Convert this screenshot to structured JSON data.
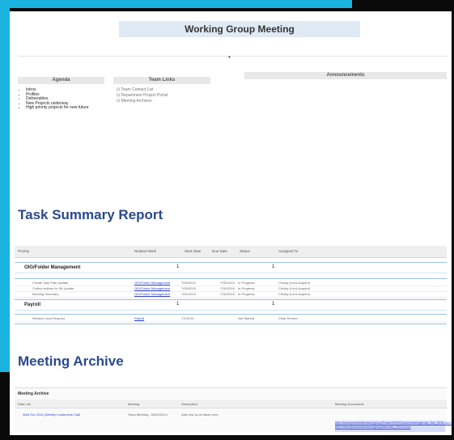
{
  "page": {
    "title": "Working Group Meeting",
    "separator_glyph": "•"
  },
  "agenda": {
    "heading": "Agenda",
    "items": [
      "Intros",
      "Profiles",
      "Deliverables",
      "New Projects underway",
      "High priority projects for new future"
    ]
  },
  "team_links": {
    "heading": "Team Links",
    "items": [
      "Team Contact List",
      "Department Project Portal",
      "Meeting Archives"
    ]
  },
  "announcements": {
    "heading": "Announcements"
  },
  "task_summary": {
    "title": "Task Summary Report",
    "columns": [
      "Priority",
      "Related Work",
      "Start Date",
      "Due Date",
      "Status",
      "Assigned To"
    ],
    "groups": [
      {
        "label": "OIG/Folder Management",
        "count_left": "1",
        "count_right": "1",
        "rows": [
          [
            "Create Task Plan Update",
            "OIG/Folder Management",
            "7/05/2015",
            "7/30/2015",
            "In Progress",
            "Christy (Lord-Acquire)"
          ],
          [
            "Collect actions for IM Update",
            "OIG/Folder Management",
            "7/05/2015",
            "7/30/2015",
            "In Progress",
            "Christy (Lord-Acquire)"
          ],
          [
            "Meeting Summary",
            "OIG/Folder Management",
            "7/01/2015",
            "7/30/2015",
            "In Progress",
            "Christy (Lord-Acquire)"
          ]
        ]
      },
      {
        "label": "Payroll",
        "count_left": "1",
        "count_right": "1",
        "rows": [
          [
            "Review Local Request",
            "Payroll",
            "7/1/2015",
            "",
            "Not Started",
            "Clear Renner"
          ]
        ]
      }
    ]
  },
  "meeting_archive": {
    "title": "Meeting Archive",
    "panel_heading": "Meeting Archive",
    "columns": [
      "Date List",
      "Meeting",
      "Description",
      "Meeting Documents"
    ],
    "row": {
      "date": "Wed Oct 2014 (Weekly Leadership Call)",
      "meeting": "Team Meeting - 08/20/2014",
      "description": "Add new to-do ideas here",
      "documents": [
        "http://sharepoint/sites/workgroup/Shared%20Documents/Agenda_Oct_2014.docx",
        "http://sharepoint/sites/workgroup/Minutes_2014.docx"
      ]
    }
  }
}
